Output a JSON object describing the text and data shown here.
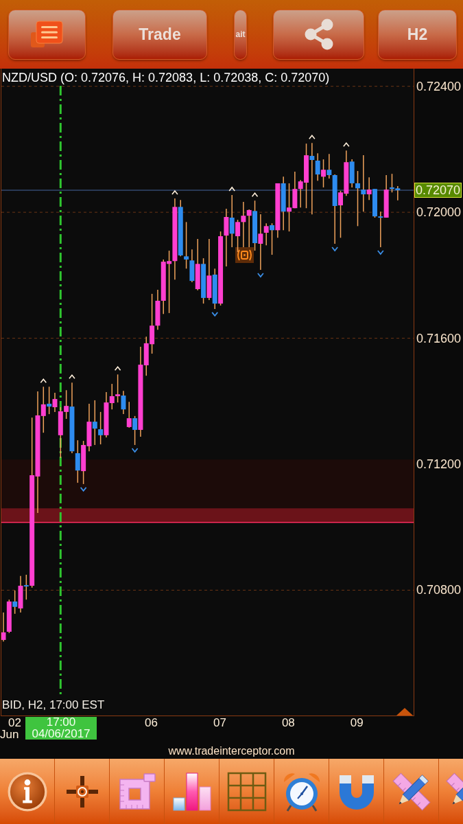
{
  "top_bar": {
    "trade_button": "Trade",
    "partial_button": "ait",
    "timeframe_button": "H2"
  },
  "chart": {
    "title": "NZD/USD (O: 0.72076, H: 0.72083, L: 0.72038, C: 0.72070)",
    "current_price": "0.72070",
    "info": "BID, H2, 17:00 EST",
    "session_label": {
      "day": "02",
      "month": "Jun"
    },
    "cursor_label": {
      "time": "17:00",
      "date": "04/06/2017"
    },
    "chart_data": {
      "type": "candlestick",
      "x": [
        3.875,
        3.9583,
        4.0417,
        4.125,
        4.2083,
        4.2917,
        4.375,
        4.4583,
        4.5417,
        4.625,
        4.7083,
        4.7917,
        4.875,
        4.9583,
        5.0417,
        5.125,
        5.2083,
        5.2917,
        5.375,
        5.4583,
        5.5417,
        5.625,
        5.7083,
        5.7917,
        5.875,
        5.9583,
        6.0417,
        6.125,
        6.2083,
        6.2917,
        6.375,
        6.4583,
        6.5417,
        6.625,
        6.7083,
        6.7917,
        6.875,
        6.9583,
        7.0417,
        7.125,
        7.2083,
        7.2917,
        7.375,
        7.4583,
        7.5417,
        7.625,
        7.7083,
        7.7917,
        7.875,
        7.9583,
        8.0417,
        8.125,
        8.2083,
        8.2917,
        8.375,
        8.4583,
        8.5417,
        8.625,
        8.7083,
        8.7917,
        8.875,
        8.9583,
        9.0417,
        9.125,
        9.2083,
        9.2917,
        9.375,
        9.4583,
        9.5417,
        9.625
      ],
      "ohlc": [
        [
          0.70642,
          0.70729,
          0.70637,
          0.70666
        ],
        [
          0.70668,
          0.7077,
          0.70664,
          0.70764
        ],
        [
          0.70764,
          0.70799,
          0.70725,
          0.70747
        ],
        [
          0.70742,
          0.70845,
          0.70729,
          0.70814
        ],
        [
          0.70816,
          0.70849,
          0.7077,
          0.70812
        ],
        [
          0.70814,
          0.71348,
          0.70808,
          0.71165
        ],
        [
          0.71161,
          0.71431,
          0.71045,
          0.71355
        ],
        [
          0.71353,
          0.71446,
          0.713,
          0.7139
        ],
        [
          0.71392,
          0.71446,
          0.71359,
          0.71383
        ],
        [
          0.71381,
          0.71427,
          0.71366,
          0.71407
        ],
        [
          0.71292,
          0.71381,
          0.7122,
          0.71368
        ],
        [
          0.71366,
          0.71435,
          0.71344,
          0.71385
        ],
        [
          0.71383,
          0.71459,
          0.71235,
          0.71241
        ],
        [
          0.71235,
          0.71276,
          0.71141,
          0.7118
        ],
        [
          0.71178,
          0.71274,
          0.71137,
          0.71261
        ],
        [
          0.71257,
          0.71392,
          0.71241,
          0.71335
        ],
        [
          0.71335,
          0.71403,
          0.71261,
          0.71313
        ],
        [
          0.71311,
          0.71366,
          0.71263,
          0.71292
        ],
        [
          0.71292,
          0.71429,
          0.71285,
          0.71396
        ],
        [
          0.71394,
          0.71455,
          0.71374,
          0.71416
        ],
        [
          0.71416,
          0.71485,
          0.71396,
          0.71422
        ],
        [
          0.71418,
          0.71433,
          0.71359,
          0.71374
        ],
        [
          0.71318,
          0.71398,
          0.71316,
          0.71346
        ],
        [
          0.71346,
          0.71353,
          0.71261,
          0.71309
        ],
        [
          0.71309,
          0.71573,
          0.71287,
          0.71516
        ],
        [
          0.71514,
          0.71605,
          0.71481,
          0.71584
        ],
        [
          0.71581,
          0.71741,
          0.71551,
          0.7164
        ],
        [
          0.7164,
          0.71754,
          0.71627,
          0.71719
        ],
        [
          0.71719,
          0.7185,
          0.71677,
          0.71843
        ],
        [
          0.71836,
          0.71878,
          0.7168,
          0.71845
        ],
        [
          0.71845,
          0.72044,
          0.71786,
          0.72017
        ],
        [
          0.72017,
          0.72039,
          0.7186,
          0.71863
        ],
        [
          0.7186,
          0.71969,
          0.71821,
          0.7185
        ],
        [
          0.71847,
          0.71882,
          0.71778,
          0.71782
        ],
        [
          0.71756,
          0.71915,
          0.71752,
          0.71836
        ],
        [
          0.71836,
          0.71854,
          0.7171,
          0.71728
        ],
        [
          0.71728,
          0.71915,
          0.71721,
          0.71799
        ],
        [
          0.71802,
          0.71821,
          0.71693,
          0.7171
        ],
        [
          0.7171,
          0.71939,
          0.71704,
          0.71924
        ],
        [
          0.71926,
          0.72011,
          0.71828,
          0.71985
        ],
        [
          0.71983,
          0.72055,
          0.71889,
          0.71932
        ],
        [
          0.71924,
          0.71976,
          0.71874,
          0.71969
        ],
        [
          0.71969,
          0.72033,
          0.71889,
          0.71989
        ],
        [
          0.71989,
          0.72009,
          0.71889,
          0.72007
        ],
        [
          0.72004,
          0.72037,
          0.71878,
          0.71902
        ],
        [
          0.719,
          0.71994,
          0.71817,
          0.71932
        ],
        [
          0.71935,
          0.71965,
          0.71895,
          0.71956
        ],
        [
          0.71959,
          0.71965,
          0.71865,
          0.71943
        ],
        [
          0.71943,
          0.72092,
          0.71919,
          0.72092
        ],
        [
          0.72092,
          0.72113,
          0.71943,
          0.72002
        ],
        [
          0.72002,
          0.72092,
          0.71939,
          0.72015
        ],
        [
          0.72013,
          0.72129,
          0.72013,
          0.72074
        ],
        [
          0.72074,
          0.72102,
          0.72015,
          0.72098
        ],
        [
          0.72094,
          0.72218,
          0.72013,
          0.72181
        ],
        [
          0.72179,
          0.7222,
          0.71993,
          0.72166
        ],
        [
          0.72164,
          0.72187,
          0.721,
          0.7212
        ],
        [
          0.72113,
          0.72168,
          0.72079,
          0.72135
        ],
        [
          0.72135,
          0.72185,
          0.72107,
          0.72118
        ],
        [
          0.72118,
          0.7212,
          0.719,
          0.7202
        ],
        [
          0.72022,
          0.72068,
          0.71919,
          0.72063
        ],
        [
          0.72059,
          0.72196,
          0.72052,
          0.72159
        ],
        [
          0.72161,
          0.72168,
          0.72079,
          0.72092
        ],
        [
          0.72092,
          0.72131,
          0.71956,
          0.72076
        ],
        [
          0.72072,
          0.72181,
          0.72002,
          0.72057
        ],
        [
          0.72057,
          0.72111,
          0.72039,
          0.72072
        ],
        [
          0.72074,
          0.72074,
          0.71983,
          0.71987
        ],
        [
          0.71987,
          0.72002,
          0.71889,
          0.71983
        ],
        [
          0.71983,
          0.72118,
          0.71983,
          0.72072
        ],
        [
          0.72079,
          0.72122,
          0.72063,
          0.72074
        ],
        [
          0.72076,
          0.72083,
          0.72038,
          0.7207
        ]
      ],
      "xlim": [
        3.845,
        9.857
      ],
      "ylim": [
        0.70402,
        0.72456
      ],
      "grid": true,
      "bands": [
        {
          "axis": "y",
          "from": 0.7106,
          "to": 0.71215,
          "color": "#1c0b09"
        },
        {
          "axis": "y",
          "from": 0.71015,
          "to": 0.7106,
          "color": "#6b1319"
        }
      ],
      "ref_lines": [
        {
          "axis": "y",
          "value": 0.71015,
          "color": "#ff2d5f"
        },
        {
          "axis": "y",
          "value": 0.7207,
          "color": "#46679e"
        },
        {
          "axis": "x",
          "value": 4.7083,
          "color": "#2fc52f"
        }
      ],
      "yticks": [
        {
          "value": 0.724,
          "label": "0.72400"
        },
        {
          "value": 0.72,
          "label": "0.72000"
        },
        {
          "value": 0.716,
          "label": "0.71600"
        },
        {
          "value": 0.712,
          "label": "0.71200"
        },
        {
          "value": 0.708,
          "label": "0.70800"
        }
      ],
      "xticks": [
        {
          "value": 6,
          "label": "06"
        },
        {
          "value": 7,
          "label": "07"
        },
        {
          "value": 8,
          "label": "08"
        },
        {
          "value": 9,
          "label": "09"
        }
      ]
    }
  },
  "footer_link": "www.tradeinterceptor.com"
}
